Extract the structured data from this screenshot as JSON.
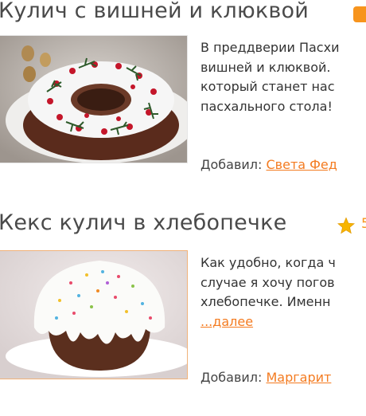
{
  "recipes": [
    {
      "title": "Кулич с вишней и клюквой",
      "description_lines": [
        "В преддверии Пасхи",
        "вишней и клюквой.",
        "который станет нас",
        "пасхального стола!"
      ],
      "added_by_label": "Добавил:",
      "author": "Света Фед"
    },
    {
      "title": "Кекс кулич в хлебопечке",
      "rating": "5",
      "description_lines": [
        "Как удобно, когда ч",
        "случае я хочу погов",
        "хлебопечке. Именн"
      ],
      "more_label": "...далее",
      "added_by_label": "Добавил:",
      "author": "Маргарит"
    }
  ],
  "colors": {
    "accent": "#f47b20",
    "star": "#f7b500",
    "title": "#4a4a4a"
  },
  "icons": {
    "badge": "comment-badge-icon",
    "rating": "star-icon"
  }
}
